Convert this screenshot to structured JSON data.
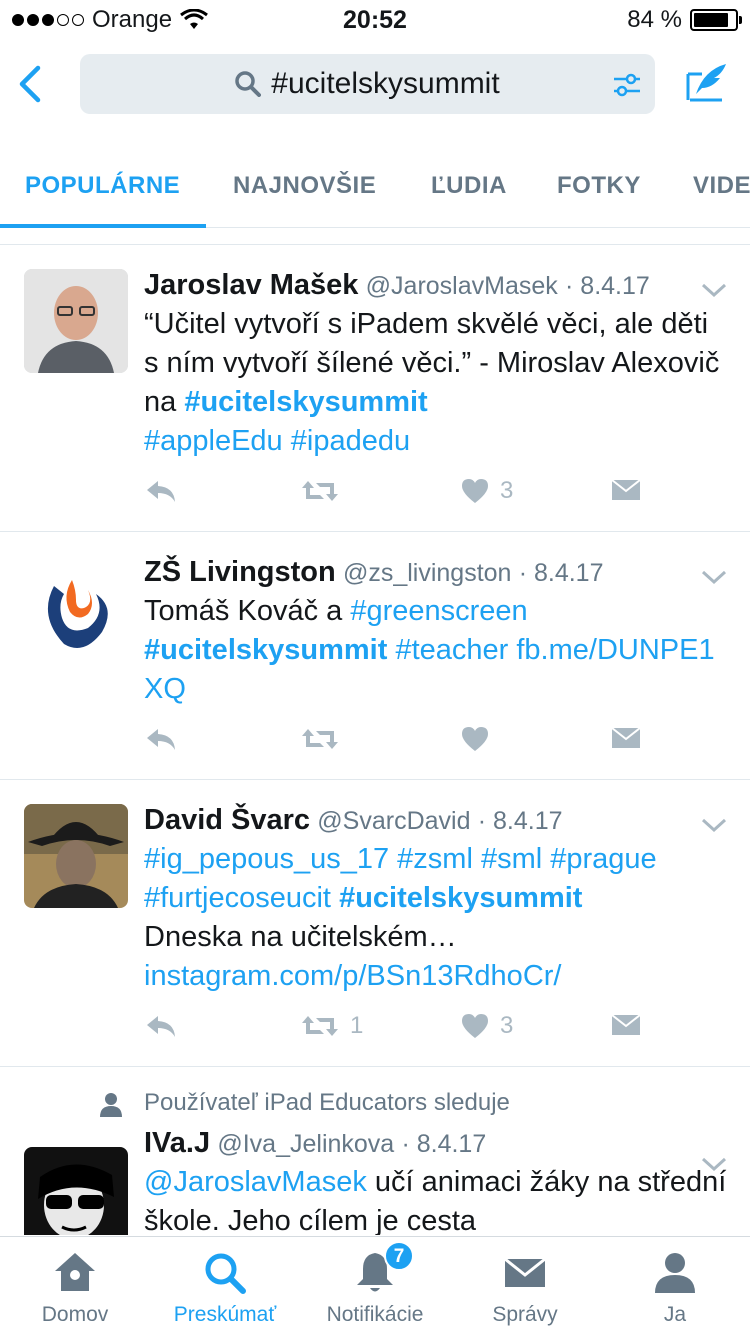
{
  "status_bar": {
    "carrier": "Orange",
    "time": "20:52",
    "battery": "84 %",
    "battery_level": 0.84,
    "signal_bars": 3
  },
  "search": {
    "query": "#ucitelskysummit"
  },
  "tabs": [
    {
      "label": "POPULÁRNE",
      "active": true
    },
    {
      "label": "NAJNOVŠIE",
      "active": false
    },
    {
      "label": "ĽUDIA",
      "active": false
    },
    {
      "label": "FOTKY",
      "active": false
    },
    {
      "label": "VIDE",
      "active": false
    }
  ],
  "tweets": [
    {
      "name": "Jaroslav Mašek",
      "handle": "@JaroslavMasek",
      "date": "· 8.4.17",
      "text_plain": "“Učitel vytvoří s iPadem skvělé věci, ale děti s ním vytvoří šílené věci.” - Miroslav Alexovič na ",
      "hashtag_bold": "#ucitelskysummit",
      "hashtags_line": "#appleEdu #ipadedu",
      "like_count": "3",
      "retweet_count": ""
    },
    {
      "name": "ZŠ Livingston",
      "handle": "@zs_livingston",
      "date": "· 8.4.17",
      "text_plain": "Tomáš Kováč a ",
      "hashtag_1": "#greenscreen",
      "hashtag_bold": "#ucitelskysummit",
      "hashtag_2": "#teacher",
      "link": "fb.me/DUNPE1XQ"
    },
    {
      "name": "David Švarc",
      "handle": "@SvarcDavid",
      "date": "· 8.4.17",
      "hashtags_line": "#ig_pepous_us_17 #zsml #sml #prague #furtjecoseucit",
      "hashtag_bold": "#ucitelskysummit",
      "text_plain": "Dneska na učitelském… ",
      "link": "instagram.com/p/BSn13RdhoCr/",
      "retweet_count": "1",
      "like_count": "3"
    },
    {
      "social_context": "Používateľ iPad Educators sleduje",
      "name": "IVa.J",
      "handle": "@Iva_Jelinkova",
      "date": "· 8.4.17",
      "mention": "@JaroslavMasek",
      "text_plain": " učí animaci žáky na střední škole. Jeho cílem je cesta"
    }
  ],
  "bottom_tabs": [
    {
      "label": "Domov",
      "icon": "home-icon",
      "active": false
    },
    {
      "label": "Preskúmať",
      "icon": "search-icon",
      "active": true
    },
    {
      "label": "Notifikácie",
      "icon": "bell-icon",
      "active": false,
      "badge": "7"
    },
    {
      "label": "Správy",
      "icon": "envelope-icon",
      "active": false
    },
    {
      "label": "Ja",
      "icon": "person-icon",
      "active": false
    }
  ],
  "colors": {
    "accent": "#1da1f2",
    "text_secondary": "#657786",
    "icon_muted": "#aab8c2",
    "search_bg": "#e6ecf0"
  }
}
